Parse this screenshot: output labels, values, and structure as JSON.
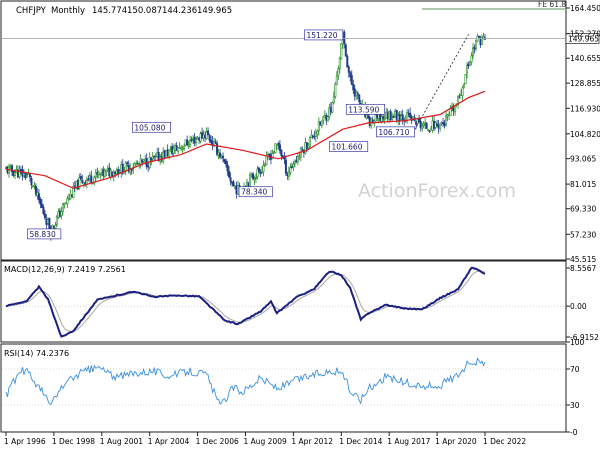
{
  "main": {
    "symbol": "CHFJPY",
    "timeframe": "Monthly",
    "ohlc": [
      "145.774",
      "150.087",
      "144.236",
      "149.965"
    ],
    "current_price_label": "149.965",
    "fe_label": "FE 61.8",
    "watermark": "ActionForex.com",
    "annotations": [
      "58.830",
      "105.080",
      "78.340",
      "151.220",
      "113.590",
      "101.660",
      "106.710"
    ],
    "yticks": [
      "164.450",
      "152.270",
      "140.655",
      "128.855",
      "116.930",
      "104.820",
      "93.065",
      "81.015",
      "69.330",
      "57.230",
      "45.515"
    ]
  },
  "macd": {
    "title": "MACD(12,26,9) 7.2419 7.2561",
    "yticks": [
      "8.5567",
      "0.00",
      "-6.9152"
    ]
  },
  "rsi": {
    "title": "RSI(14) 74.2376",
    "yticks": [
      "100",
      "70",
      "30",
      "-0"
    ]
  },
  "xaxis": {
    "labels": [
      "1 Apr 1996",
      "1 Dec 1998",
      "1 Aug 2001",
      "1 Apr 2004",
      "1 Dec 2006",
      "1 Aug 2009",
      "1 Apr 2012",
      "1 Dec 2014",
      "1 Aug 2017",
      "1 Apr 2020",
      "1 Dec 2022"
    ]
  },
  "colors": {
    "bull": "#1f8a1f",
    "bear": "#1f3a8a",
    "sma": "#e0191a",
    "macd": "#1a1f80",
    "signal": "#a8a8a8",
    "rsi": "#3a8fe0",
    "annotation_box": "#3a3aa8"
  },
  "chart_data": [
    {
      "type": "candlestick",
      "title": "CHFJPY,Monthly",
      "ylim": [
        45.515,
        164.45
      ],
      "price_path": {
        "x": [
          "1996-04",
          "1997-07",
          "1998-10",
          "1999-06",
          "2000-05",
          "2001-09",
          "2004-05",
          "2007-06",
          "2008-03",
          "2008-12",
          "2009-03",
          "2010-06",
          "2011-06",
          "2011-12",
          "2012-03",
          "2013-05",
          "2014-06",
          "2015-01",
          "2015-06",
          "2016-06",
          "2017-08",
          "2018-08",
          "2019-08",
          "2020-09",
          "2021-06",
          "2022-01",
          "2022-06",
          "2022-12"
        ],
        "y": [
          88,
          85,
          59,
          70,
          82,
          86,
          92,
          105,
          95,
          80,
          78,
          88,
          100,
          86,
          90,
          104,
          118,
          151,
          130,
          110,
          114,
          113,
          108,
          110,
          120,
          138,
          149,
          150
        ]
      },
      "sma": {
        "x": [
          "1996-04",
          "1998-06",
          "2000-01",
          "2002-01",
          "2004-01",
          "2006-01",
          "2007-06",
          "2009-06",
          "2011-06",
          "2013-01",
          "2015-01",
          "2016-06",
          "2018-06",
          "2020-06",
          "2022-01",
          "2022-12"
        ],
        "y": [
          88,
          85,
          79,
          84,
          91,
          95,
          100,
          97,
          93,
          97,
          107,
          110,
          111,
          114,
          122,
          125
        ]
      },
      "annotations": [
        {
          "x": "1999-06",
          "y": 58.83,
          "label": "58.830"
        },
        {
          "x": "2005-06",
          "y": 105.08,
          "label": "105.080"
        },
        {
          "x": "2010-06",
          "y": 78.34,
          "label": "78.340"
        },
        {
          "x": "2015-01",
          "y": 151.22,
          "label": "151.220"
        },
        {
          "x": "2015-06",
          "y": 113.59,
          "label": "113.590"
        },
        {
          "x": "2015-11",
          "y": 101.66,
          "label": "101.660"
        },
        {
          "x": "2019-01",
          "y": 106.71,
          "label": "106.710"
        }
      ],
      "horizontal_lines": [
        {
          "y": 164.45,
          "label": "FE 61.8"
        },
        {
          "y": 149.965,
          "label": "149.965"
        }
      ]
    },
    {
      "type": "line",
      "title": "MACD(12,26,9) 7.2419 7.2561",
      "ylim": [
        -6.9152,
        8.5567
      ],
      "series": [
        {
          "values_x": [
            "1996-04",
            "1997-06",
            "1998-02",
            "1998-08",
            "1999-05",
            "2000-01",
            "2001-05",
            "2002-03",
            "2003-06",
            "2004-06",
            "2006-01",
            "2007-01",
            "2007-10",
            "2008-06",
            "2009-03",
            "2010-06",
            "2011-01",
            "2011-05",
            "2012-06",
            "2013-06",
            "2014-04",
            "2014-12",
            "2015-06",
            "2016-01",
            "2016-06",
            "2017-06",
            "2018-06",
            "2019-06",
            "2020-06",
            "2021-06",
            "2022-03",
            "2022-06",
            "2022-12"
          ],
          "values_y": [
            0,
            1.2,
            4.3,
            1.6,
            -6.9,
            -5.5,
            1.4,
            2.2,
            3.3,
            2.1,
            2.4,
            2.2,
            -0.6,
            -3.2,
            -4.0,
            -1.2,
            1.0,
            -1.6,
            2.0,
            3.9,
            7.8,
            7.0,
            4.0,
            -3.0,
            -1.6,
            0.3,
            -0.5,
            -0.7,
            1.8,
            3.8,
            8.6,
            8.4,
            7.2
          ]
        }
      ]
    },
    {
      "type": "line",
      "title": "RSI(14) 74.2376",
      "ylim": [
        0,
        100
      ],
      "series": [
        {
          "values_x": [
            "1996-04",
            "1997-01",
            "1997-06",
            "1998-04",
            "1998-10",
            "1999-06",
            "2000-06",
            "2001-06",
            "2002-06",
            "2003-06",
            "2004-06",
            "2005-06",
            "2006-06",
            "2007-06",
            "2008-03",
            "2008-12",
            "2009-06",
            "2010-06",
            "2011-06",
            "2012-06",
            "2013-06",
            "2014-06",
            "2015-01",
            "2015-06",
            "2016-01",
            "2016-06",
            "2017-06",
            "2018-06",
            "2019-06",
            "2020-06",
            "2021-06",
            "2022-03",
            "2022-12"
          ],
          "values_y": [
            40,
            67,
            68,
            45,
            30,
            52,
            66,
            72,
            60,
            66,
            68,
            62,
            68,
            64,
            28,
            50,
            45,
            60,
            48,
            58,
            64,
            68,
            66,
            45,
            36,
            48,
            62,
            55,
            50,
            52,
            64,
            80,
            74
          ]
        }
      ]
    }
  ]
}
